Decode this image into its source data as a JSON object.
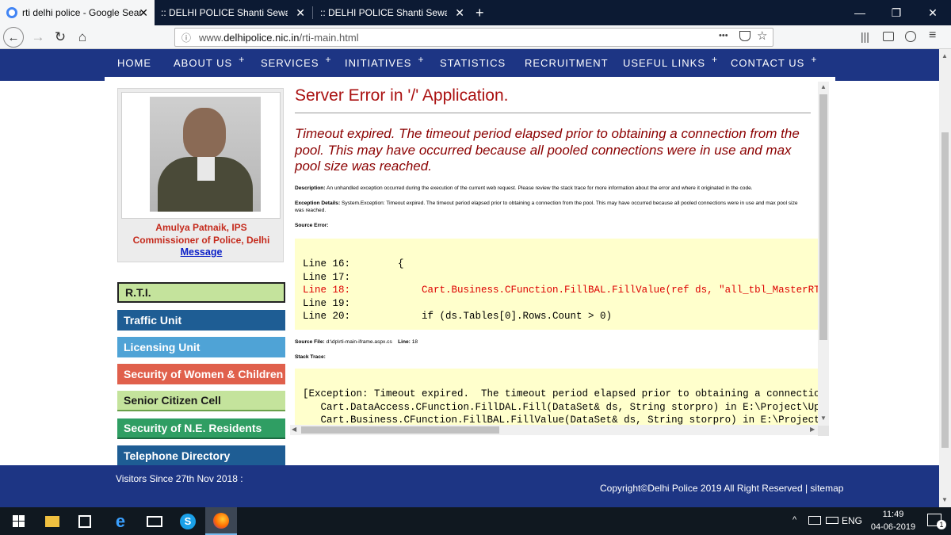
{
  "browser": {
    "tabs": [
      {
        "label": "rti delhi police - Google Search",
        "close": "✕"
      },
      {
        "label": ":: DELHI POLICE Shanti Sewa Nyaya ::",
        "close": "✕"
      },
      {
        "label": ":: DELHI POLICE Shanti Sewa Nyaya ::",
        "close": "✕"
      }
    ],
    "new_tab": "+",
    "window_controls": {
      "minimize": "—",
      "restore": "❐",
      "close": "✕"
    },
    "url_prefix": "www.",
    "url_domain": "delhipolice.nic.in",
    "url_path": "/rti-main.html",
    "url_more": "•••"
  },
  "site_menu": [
    {
      "label": "HOME",
      "plus": ""
    },
    {
      "label": "ABOUT US",
      "plus": "+"
    },
    {
      "label": "SERVICES",
      "plus": "+"
    },
    {
      "label": "INITIATIVES",
      "plus": "+"
    },
    {
      "label": "STATISTICS",
      "plus": ""
    },
    {
      "label": "RECRUITMENT",
      "plus": ""
    },
    {
      "label": "USEFUL LINKS",
      "plus": "+"
    },
    {
      "label": "CONTACT US",
      "plus": "+"
    }
  ],
  "commissioner": {
    "name": "Amulya Patnaik, IPS",
    "title": "Commissioner of Police, Delhi",
    "link": "Message"
  },
  "sidebar": [
    {
      "label": "R.T.I.",
      "color": "#c4e39c",
      "text": "#1a1a1a"
    },
    {
      "label": "Traffic Unit",
      "color": "#1e5d94",
      "text": "#ffffff"
    },
    {
      "label": "Licensing Unit",
      "color": "#4fa3d6",
      "text": "#ffffff"
    },
    {
      "label": "Security of Women & Children",
      "color": "#e0604c",
      "text": "#ffffff"
    },
    {
      "label": "Senior Citizen Cell",
      "color": "#c4e39c",
      "text": "#1a1a1a"
    },
    {
      "label": "Security of N.E. Residents",
      "color": "#2f9e63",
      "text": "#ffffff"
    },
    {
      "label": "Telephone Directory",
      "color": "#1e5d94",
      "text": "#ffffff"
    }
  ],
  "error": {
    "title": "Server Error in '/' Application.",
    "message": "Timeout expired.  The timeout period elapsed prior to obtaining a connection from the pool.  This may have occurred because all pooled connections were in use and max pool size was reached.",
    "description_label": "Description:",
    "description": "An unhandled exception occurred during the execution of the current web request. Please review the stack trace for more information about the error and where it originated in the code.",
    "details_label": "Exception Details:",
    "details_line1": "System.Exception: Timeout expired.  The timeout period elapsed prior to obtaining a connection from the pool.  This may have occurred because all pooled connections were in use and max pool size",
    "details_line2": "was reached.",
    "source_error_label": "Source Error:",
    "source_lines": [
      "Line 16:        {",
      "Line 17:",
      "Line 18:            Cart.Business.CFunction.FillBAL.FillValue(ref ds, \"all_tbl_MasterRTI\");",
      "Line 19:",
      "Line 20:            if (ds.Tables[0].Rows.Count > 0)"
    ],
    "source_file_label": "Source File:",
    "source_file": "d:\\dp\\rti-main-iframe.aspx.cs",
    "line_label": "Line:",
    "line_number": "18",
    "stack_trace_label": "Stack Trace:",
    "stack_lines": [
      "[Exception: Timeout expired.  The timeout period elapsed prior to obtaining a connection from",
      "   Cart.DataAccess.CFunction.FillDAL.Fill(DataSet& ds, String storpro) in E:\\Project\\Upload D",
      "   Cart.Business.CFunction.FillBAL.FillValue(DataSet& ds, String storpro) in E:\\Project\\Uploa"
    ]
  },
  "footer": {
    "visitors": "Visitors Since 27th Nov 2018 :",
    "copyright": "Copyright©Delhi Police 2019 All Right Reserved | sitemap"
  },
  "taskbar": {
    "language": "ENG",
    "time": "11:49",
    "date": "04-06-2019",
    "notification_count": "1"
  },
  "colors": {
    "menu_bar": "#1d3584",
    "error_title": "#aa1111",
    "code_background": "#ffffcc",
    "tab_strip": "#0c1a33"
  }
}
